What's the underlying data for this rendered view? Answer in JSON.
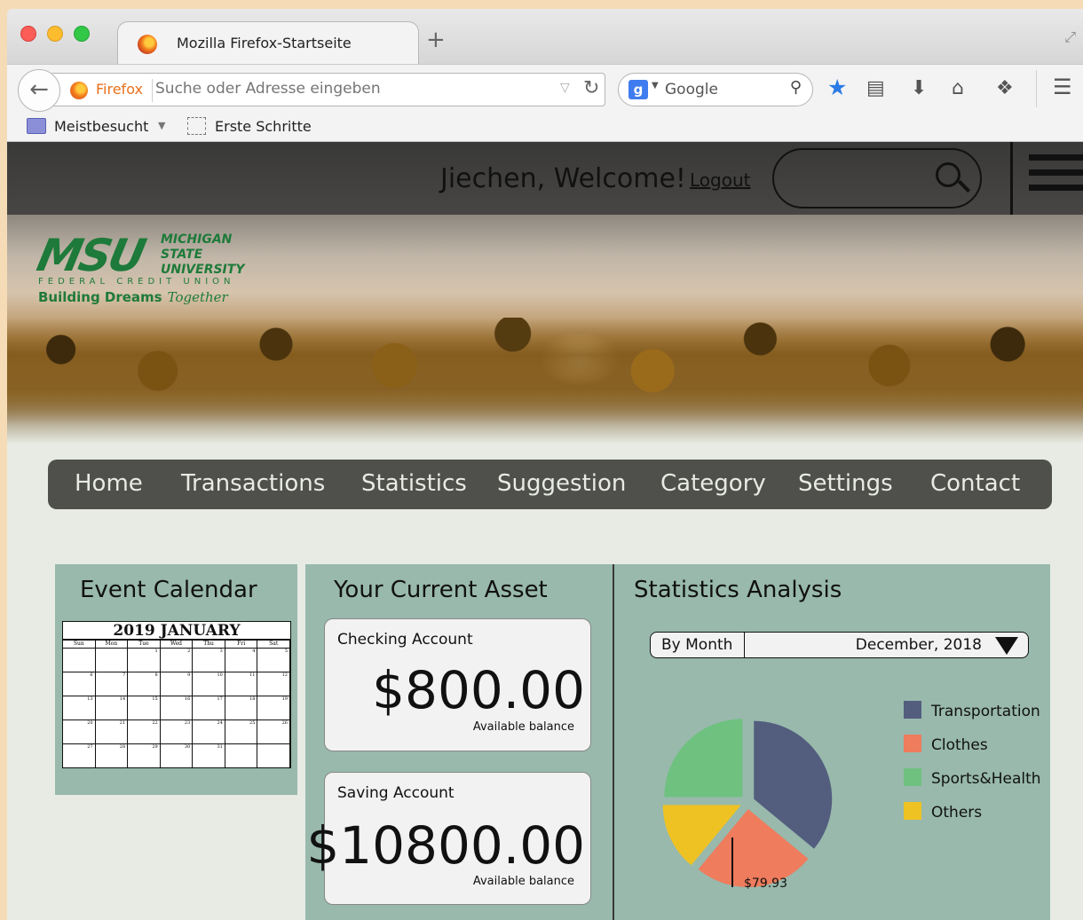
{
  "browser": {
    "tab_title": "Mozilla Firefox-Startseite",
    "new_tab": "+",
    "identity_label": "Firefox",
    "url_placeholder": "Suche oder Adresse eingeben",
    "search_engine": "Google",
    "bookmarks": [
      "Meistbesucht",
      "Erste Schritte"
    ]
  },
  "site": {
    "welcome": "Jiechen, Welcome!",
    "logout": "Logout",
    "logo": {
      "mark": "MSU",
      "name_lines": [
        "Michigan",
        "State",
        "University"
      ],
      "fcu": "FEDERAL CREDIT UNION",
      "tagline": "Building Dreams",
      "tagline_script": "Together"
    },
    "nav": [
      "Home",
      "Transactions",
      "Statistics",
      "Suggestion",
      "Category",
      "Settings",
      "Contact"
    ]
  },
  "calendar_panel": {
    "title": "Event Calendar",
    "calendar_title": "2019 JANUARY",
    "weekdays": [
      "Sun",
      "Mon",
      "Tue",
      "Wed",
      "Thu",
      "Fri",
      "Sat"
    ],
    "days": [
      "",
      "",
      "1",
      "2",
      "3",
      "4",
      "5",
      "6",
      "7",
      "8",
      "9",
      "10",
      "11",
      "12",
      "13",
      "14",
      "15",
      "16",
      "17",
      "18",
      "19",
      "20",
      "21",
      "22",
      "23",
      "24",
      "25",
      "26",
      "27",
      "28",
      "29",
      "30",
      "31",
      "",
      ""
    ]
  },
  "asset_panel": {
    "title": "Your Current Asset",
    "accounts": [
      {
        "label": "Checking Account",
        "amount": "$800.00",
        "sub": "Available balance"
      },
      {
        "label": "Saving Account",
        "amount": "$10800.00",
        "sub": "Available balance"
      }
    ]
  },
  "stats_panel": {
    "title": "Statistics Analysis",
    "mode": "By Month",
    "period": "December, 2018",
    "value_label": "$79.93",
    "legend": [
      {
        "label": "Transportation",
        "color": "#535d7e"
      },
      {
        "label": "Clothes",
        "color": "#ee7c5d"
      },
      {
        "label": "Sports&Health",
        "color": "#6fc180"
      },
      {
        "label": "Others",
        "color": "#efc223"
      }
    ]
  },
  "chart_data": {
    "type": "pie",
    "categories": [
      "Transportation",
      "Clothes",
      "Others",
      "Sports&Health"
    ],
    "values": [
      36,
      25,
      14,
      25
    ],
    "colors": [
      "#535d7e",
      "#ee7c5d",
      "#efc223",
      "#6fc180"
    ],
    "annotations": [
      {
        "category": "Sports&Health",
        "text": "$79.93"
      }
    ]
  }
}
